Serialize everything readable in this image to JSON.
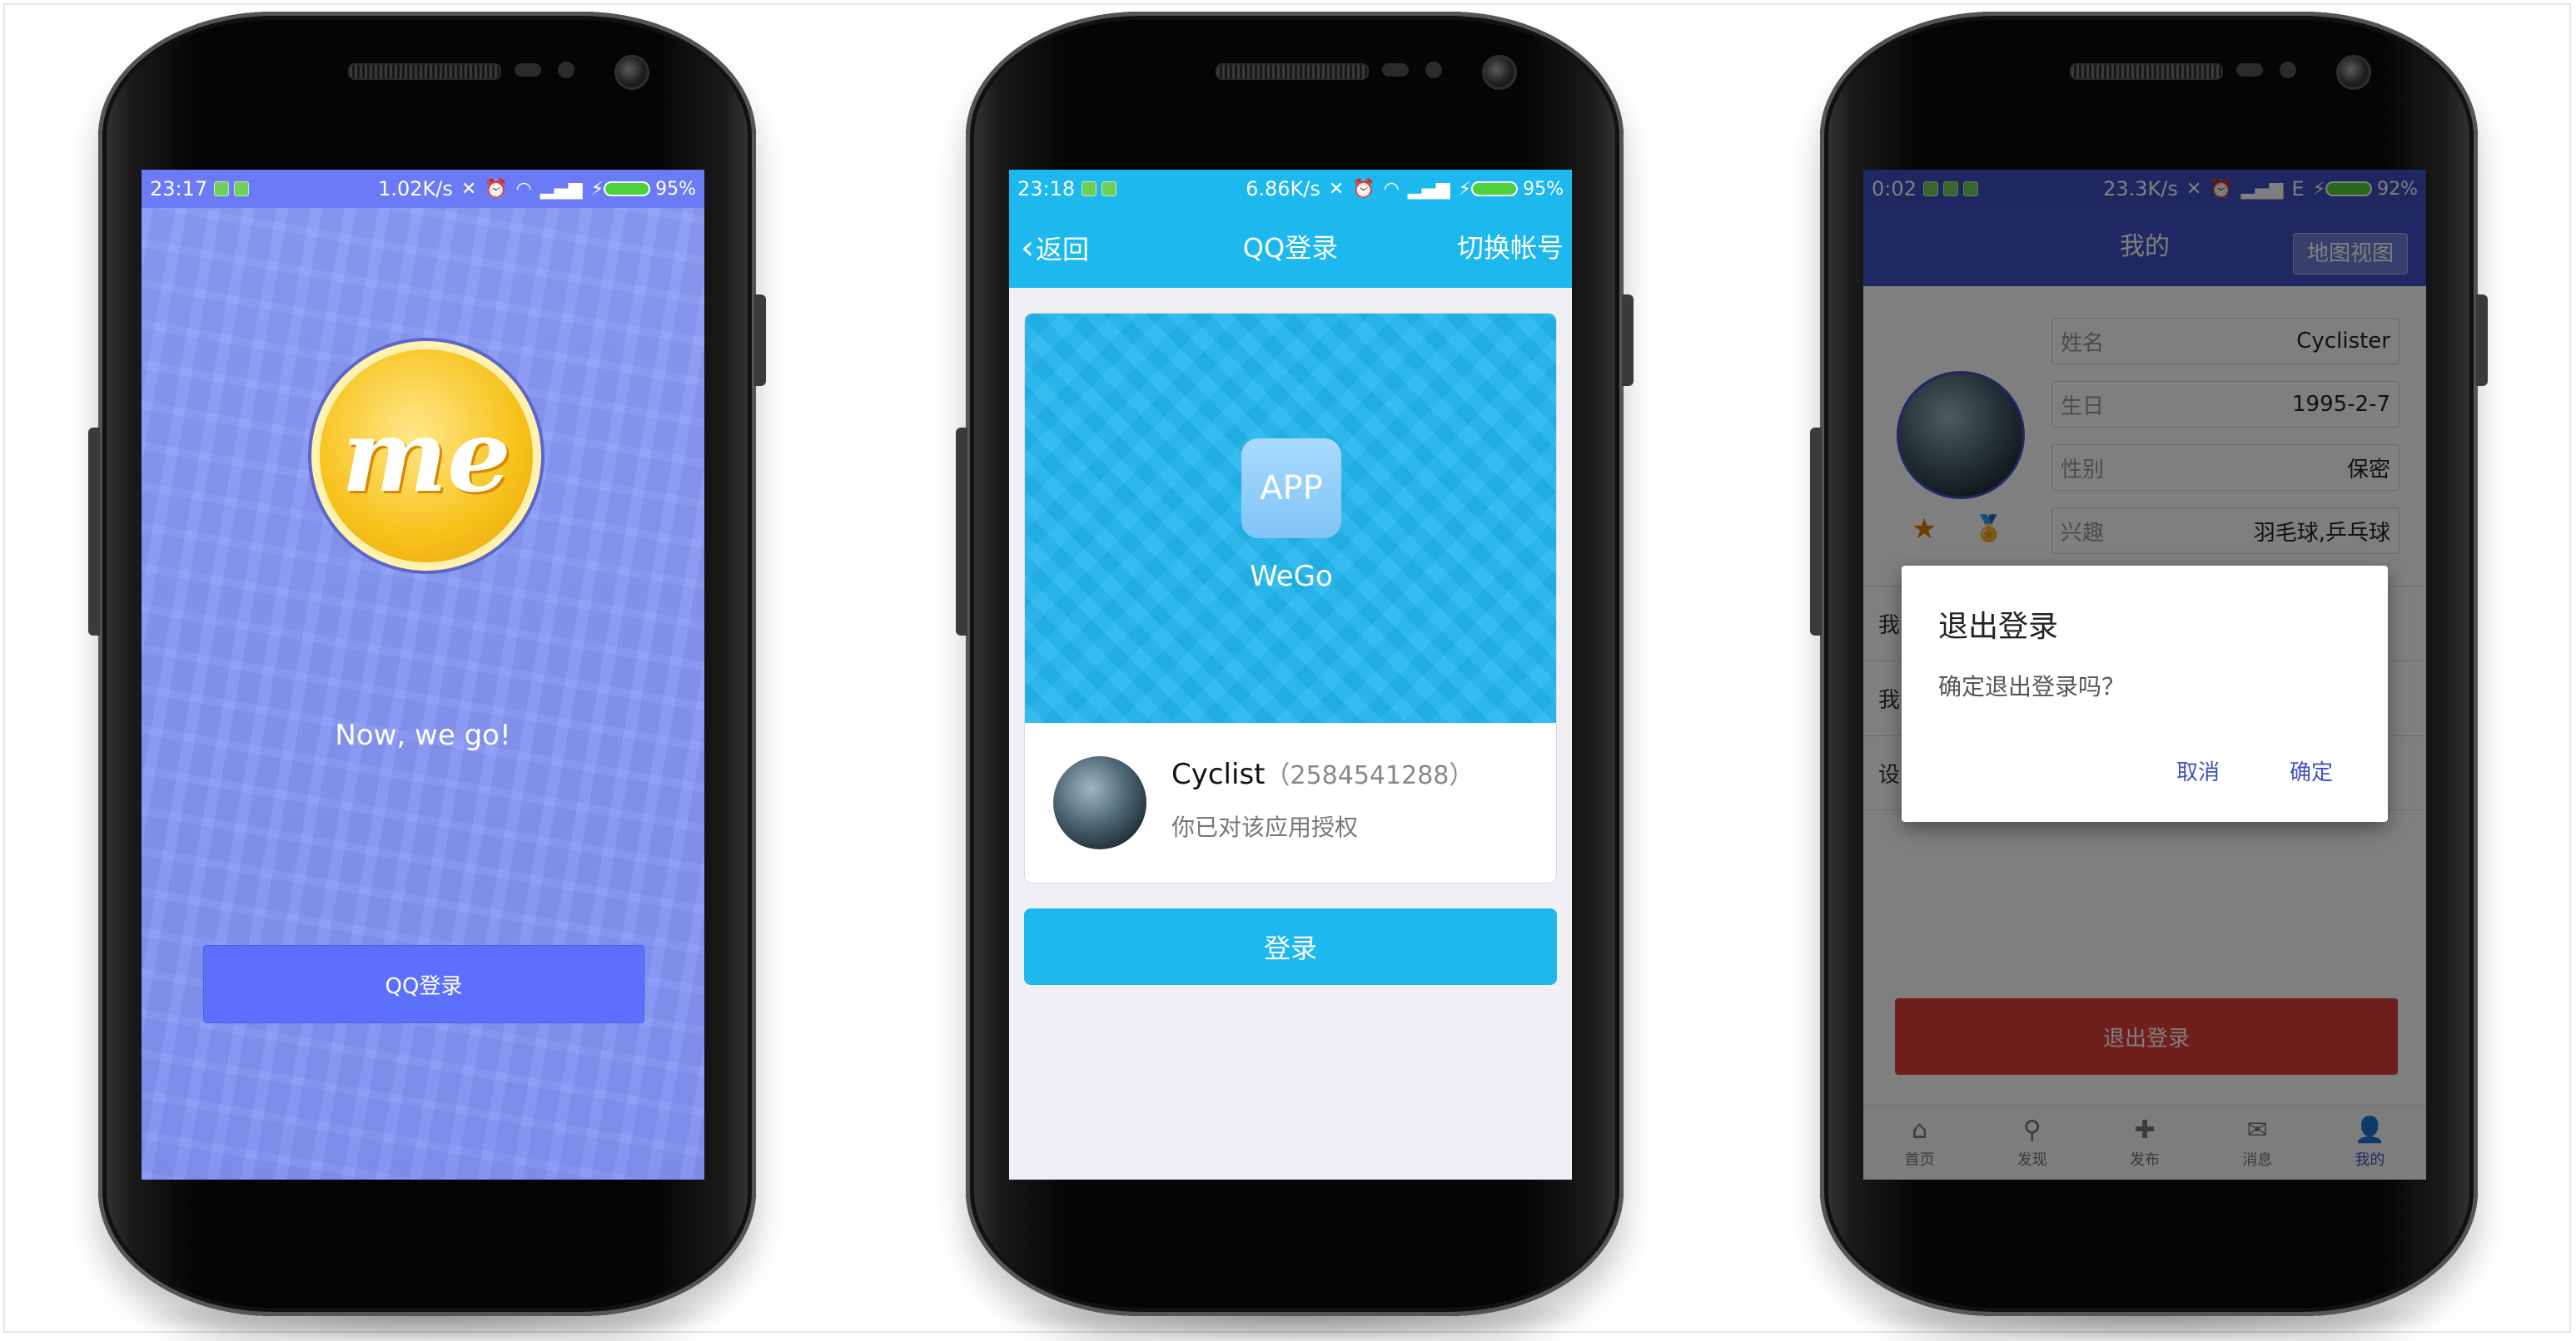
{
  "phone1": {
    "status": {
      "time": "23:17",
      "speed": "1.02K/s",
      "battery": "95%"
    },
    "slogan": "Now,  we go!",
    "logo_text": "me",
    "qq_login_label": "QQ登录"
  },
  "phone2": {
    "status": {
      "time": "23:18",
      "speed": "6.86K/s",
      "battery": "95%"
    },
    "nav": {
      "back_label": "返回",
      "title": "QQ登录",
      "switch_label": "切换帐号"
    },
    "app": {
      "icon_label": "APP",
      "name": "WeGo"
    },
    "user": {
      "name": "Cyclist",
      "id": "（2584541288）",
      "authorized": "你已对该应用授权"
    },
    "login_label": "登录"
  },
  "phone3": {
    "status": {
      "time": "0:02",
      "speed": "23.3K/s",
      "network": "E",
      "battery": "92%"
    },
    "header": {
      "title": "我的",
      "map_button": "地图视图"
    },
    "profile": [
      {
        "key": "姓名",
        "value": "Cyclister"
      },
      {
        "key": "生日",
        "value": "1995-2-7"
      },
      {
        "key": "性别",
        "value": "保密"
      },
      {
        "key": "兴趣",
        "value": "羽毛球,乒乓球"
      }
    ],
    "menu": [
      "我",
      "我",
      "设"
    ],
    "logout_label": "退出登录",
    "dialog": {
      "title": "退出登录",
      "message": "确定退出登录吗？",
      "cancel": "取消",
      "ok": "确定"
    },
    "tabs": [
      {
        "icon": "home-icon",
        "label": "首页"
      },
      {
        "icon": "search-icon",
        "label": "发现"
      },
      {
        "icon": "plus-icon",
        "label": "发布"
      },
      {
        "icon": "mail-icon",
        "label": "消息"
      },
      {
        "icon": "user-icon",
        "label": "我的"
      }
    ],
    "active_tab": 4
  },
  "colors": {
    "screen1_bg": "#8596f7",
    "qq_button": "#5d70fb",
    "qq_blue": "#1cb8ee",
    "indigo": "#3f51c5",
    "logout_red": "#e04038"
  }
}
